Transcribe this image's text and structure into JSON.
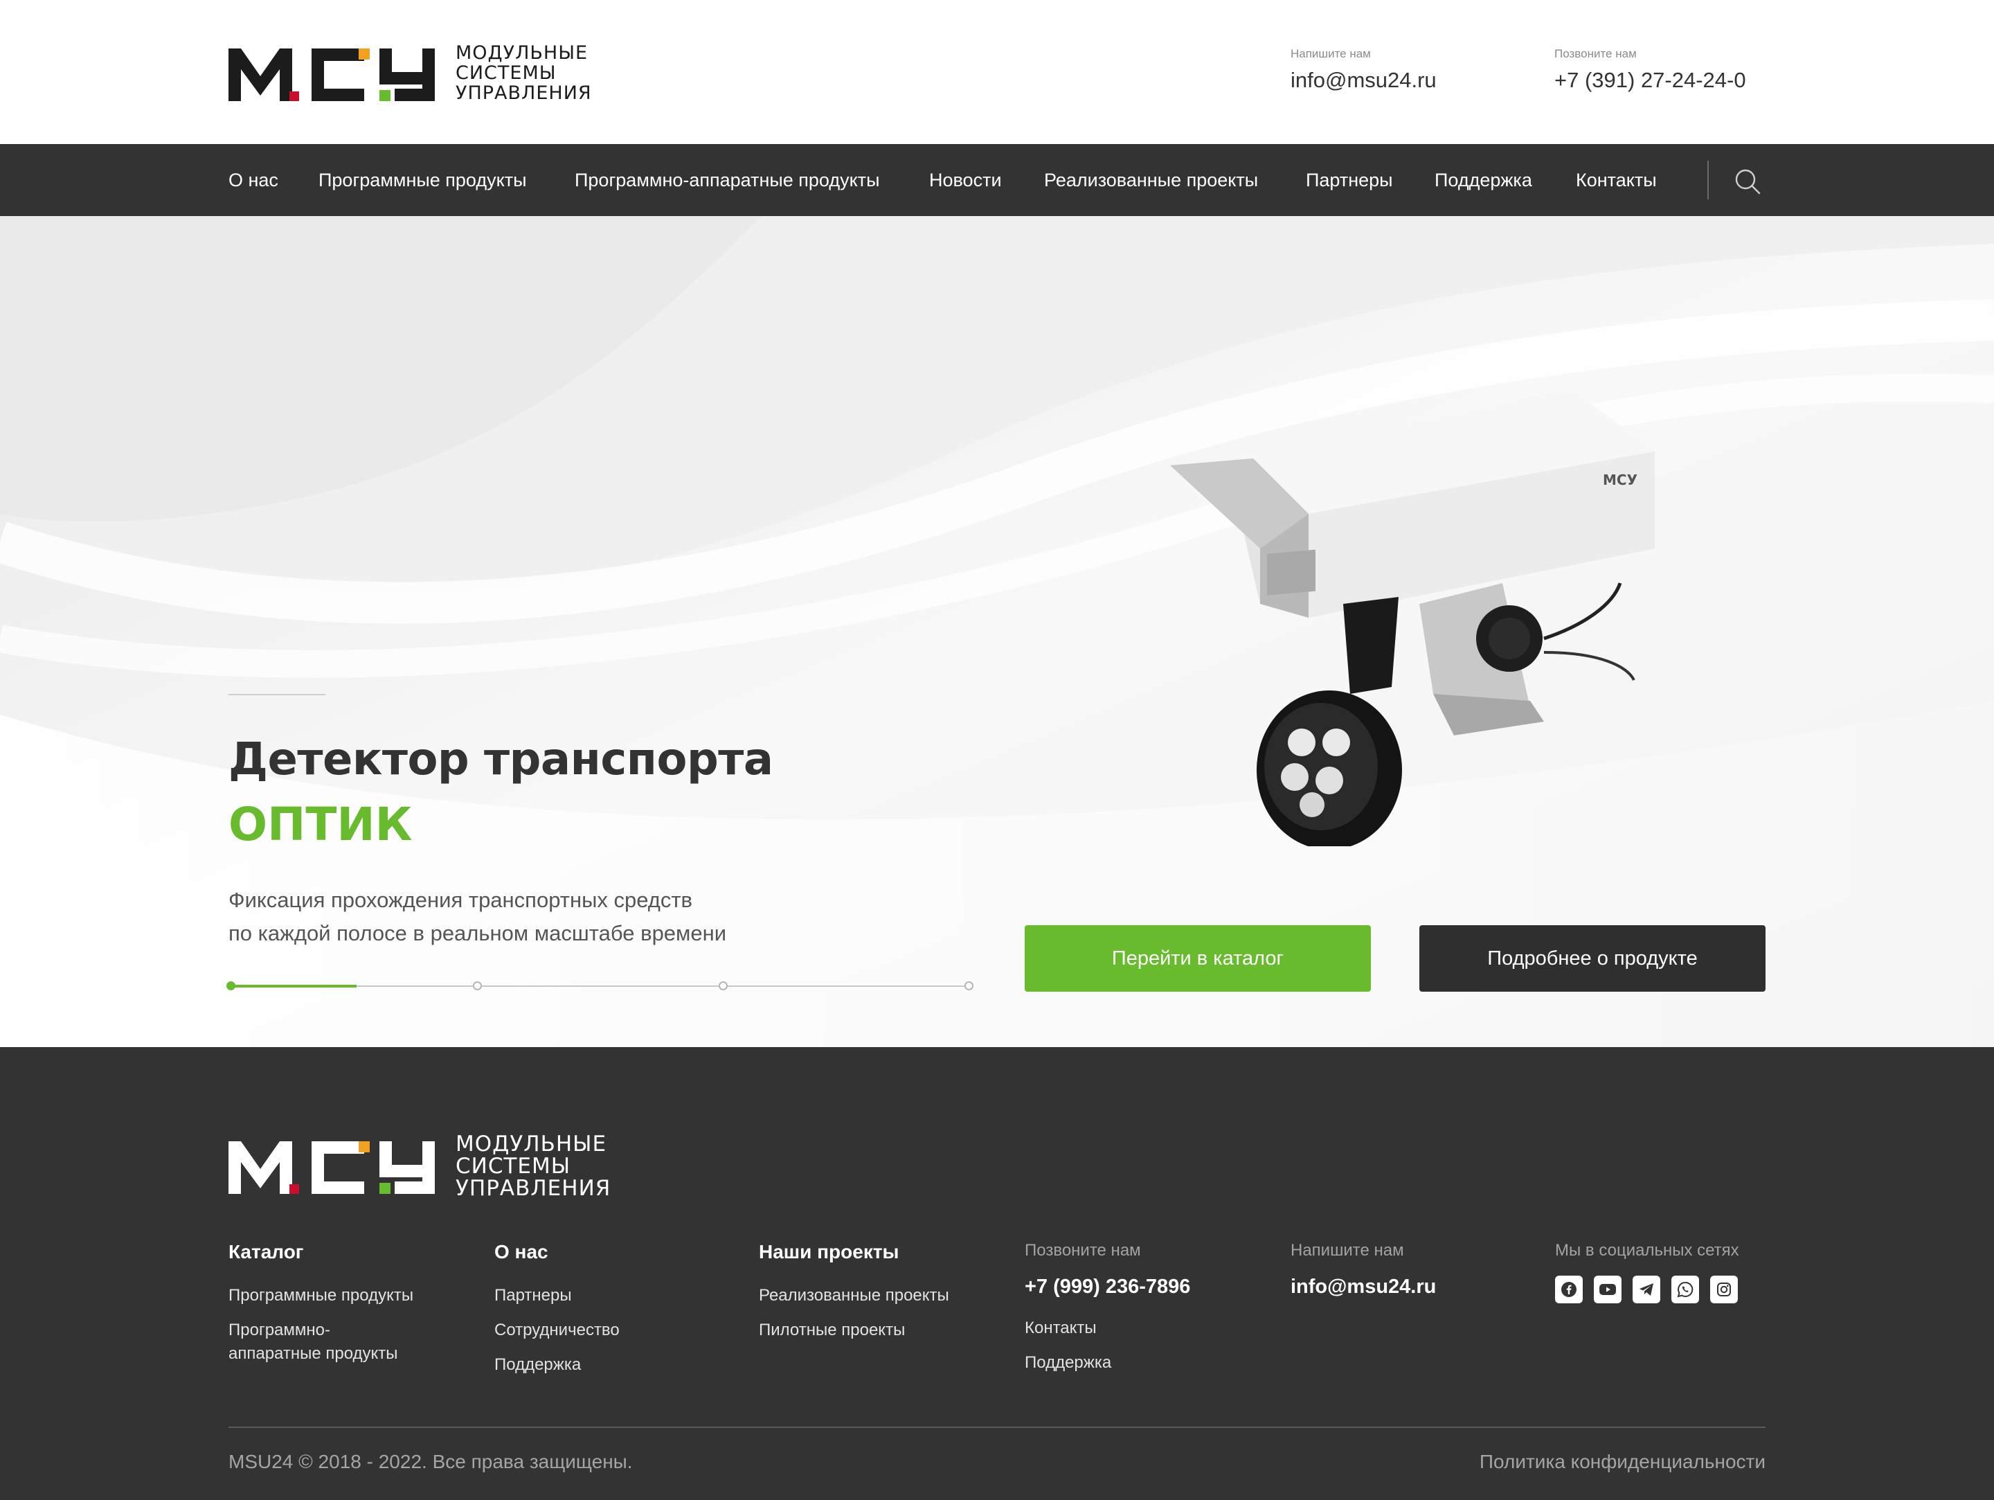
{
  "header": {
    "logo": {
      "mark": "МСУ",
      "line1": "Модульные",
      "line2": "системы",
      "line3": "управления"
    },
    "email_caption": "Напишите нам",
    "email": "info@msu24.ru",
    "phone_caption": "Позвоните нам",
    "phone": "+7 (391) 27-24-24-0"
  },
  "nav": {
    "items": [
      {
        "label": "О нас"
      },
      {
        "label": "Программные продукты"
      },
      {
        "label": "Программно-аппаратные продукты"
      },
      {
        "label": "Новости"
      },
      {
        "label": "Реализованные проекты"
      },
      {
        "label": "Партнеры"
      },
      {
        "label": "Поддержка"
      },
      {
        "label": "Контакты"
      }
    ],
    "search_icon": "search-icon"
  },
  "hero": {
    "title": "Детектор транспорта",
    "accent": "ОПТИК",
    "desc_line1": "Фиксация прохождения транспортных средств",
    "desc_line2": "по каждой полосе в реальном масштабе времени",
    "slides_total": 4,
    "slide_active": 1,
    "slide_progress": 0.17,
    "catalog_button": "Перейти в каталог",
    "more_button": "Подробнее о продукте",
    "camera_label": "МСУ"
  },
  "footer": {
    "logo": {
      "mark": "МСУ",
      "line1": "Модульные",
      "line2": "системы",
      "line3": "управления"
    },
    "catalog": {
      "title": "Каталог",
      "links": [
        "Программные продукты",
        "Программно-",
        "аппаратные продукты"
      ]
    },
    "about": {
      "title": "О нас",
      "links": [
        "Партнеры",
        "Сотрудничество",
        "Поддержка"
      ]
    },
    "projects": {
      "title": "Наши проекты",
      "links": [
        "Реализованные проекты",
        "Пилотные проекты"
      ]
    },
    "call": {
      "caption": "Позвоните нам",
      "phone": "+7 (999) 236-7896",
      "links": [
        "Контакты",
        "Поддержка"
      ]
    },
    "write": {
      "caption": "Напишите нам",
      "email": "info@msu24.ru"
    },
    "social": {
      "caption": "Мы в социальных сетях",
      "icons": [
        "facebook-icon",
        "youtube-icon",
        "telegram-icon",
        "whatsapp-icon",
        "instagram-icon"
      ]
    },
    "copyright": "MSU24 © 2018 - 2022. Все права защищены.",
    "policy": "Политика конфиденциальности"
  },
  "colors": {
    "accent_green": "#68bb2c",
    "dark": "#333333",
    "logo_red": "#c8102e",
    "logo_orange": "#f2a01f"
  }
}
